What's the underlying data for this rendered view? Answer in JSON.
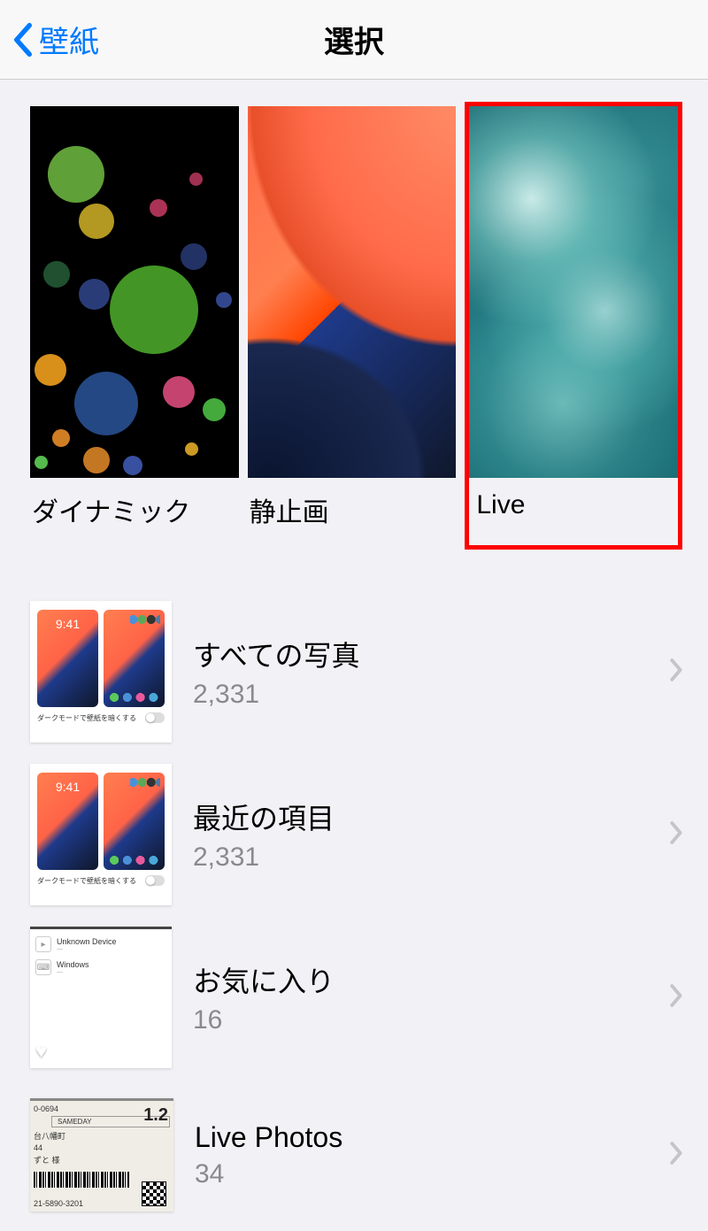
{
  "header": {
    "back_label": "壁紙",
    "title": "選択"
  },
  "wallpaper_categories": [
    {
      "label": "ダイナミック",
      "highlighted": false
    },
    {
      "label": "静止画",
      "highlighted": false
    },
    {
      "label": "Live",
      "highlighted": true
    }
  ],
  "albums": [
    {
      "title": "すべての写真",
      "count": "2,331"
    },
    {
      "title": "最近の項目",
      "count": "2,331"
    },
    {
      "title": "お気に入り",
      "count": "16"
    },
    {
      "title": "Live Photos",
      "count": "34"
    }
  ],
  "mini": {
    "dark_mode_caption": "ダークモードで壁紙を暗くする"
  }
}
